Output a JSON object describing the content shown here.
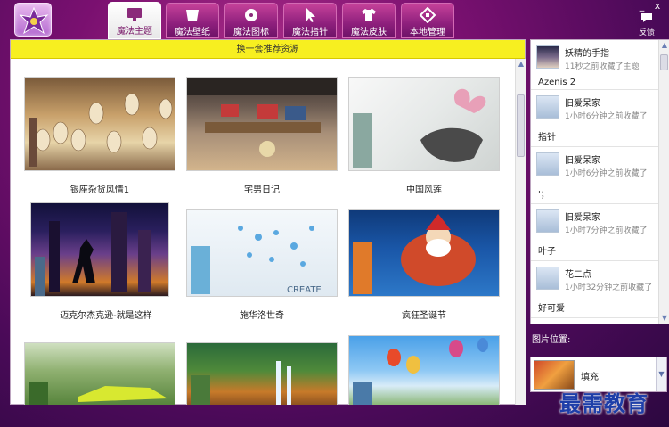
{
  "tabs": [
    {
      "label": "魔法主题",
      "icon": "monitor-icon",
      "active": true
    },
    {
      "label": "魔法壁纸",
      "icon": "wallpaper-icon",
      "active": false
    },
    {
      "label": "魔法图标",
      "icon": "icons-icon",
      "active": false
    },
    {
      "label": "魔法指针",
      "icon": "cursor-icon",
      "active": false
    },
    {
      "label": "魔法皮肤",
      "icon": "shirt-icon",
      "active": false
    },
    {
      "label": "本地管理",
      "icon": "manage-icon",
      "active": false
    }
  ],
  "window": {
    "minimize": "_",
    "close": "x"
  },
  "feedback": {
    "label": "反馈",
    "icon": "chat-icon"
  },
  "banner": "换一套推荐资源",
  "themes": [
    {
      "name": "银座杂货风情1"
    },
    {
      "name": "宅男日记"
    },
    {
      "name": "中国风莲"
    },
    {
      "name": "迈克尔杰克逊-就是这样"
    },
    {
      "name": "施华洛世奇"
    },
    {
      "name": "疯狂圣诞节"
    },
    {
      "name": ""
    },
    {
      "name": ""
    },
    {
      "name": ""
    }
  ],
  "activity": [
    {
      "user": "妖精的手指",
      "time": "11秒之前收藏了主题",
      "item": "Azenis 2",
      "avatar": "photo"
    },
    {
      "user": "旧爱呆家",
      "time": "1小时6分钟之前收藏了",
      "item": "指针",
      "avatar": "default"
    },
    {
      "user": "旧爱呆家",
      "time": "1小时6分钟之前收藏了",
      "item": "'；",
      "avatar": "default"
    },
    {
      "user": "旧爱呆家",
      "time": "1小时7分钟之前收藏了",
      "item": "叶子",
      "avatar": "default"
    },
    {
      "user": "花二点",
      "time": "1小时32分钟之前收藏了",
      "item": "好可爱",
      "avatar": "default"
    }
  ],
  "image_position": {
    "label": "图片位置:",
    "value": "填充"
  },
  "watermark": "最需教育",
  "colors": {
    "banner": "#f7ef20",
    "accent": "#8d1f7c",
    "watermark": "#1e3ea8"
  }
}
